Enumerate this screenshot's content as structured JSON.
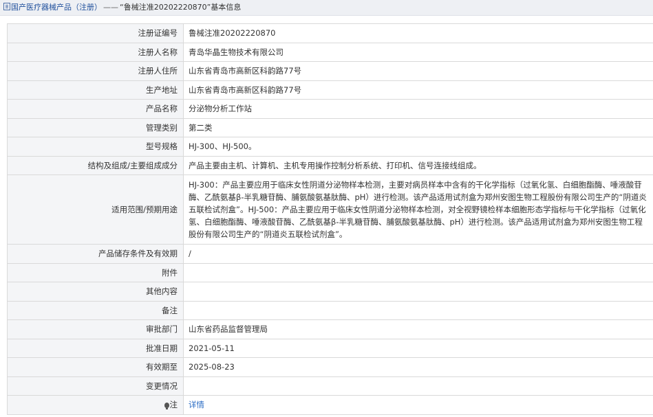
{
  "breadcrumb": {
    "home": "国产医疗器械产品（注册）",
    "separator": "——",
    "current": "“鲁械注准20202220870”基本信息"
  },
  "rows": [
    {
      "label": "注册证编号",
      "value": "鲁械注准20202220870"
    },
    {
      "label": "注册人名称",
      "value": "青岛华晶生物技术有限公司"
    },
    {
      "label": "注册人住所",
      "value": "山东省青岛市高新区科韵路77号"
    },
    {
      "label": "生产地址",
      "value": "山东省青岛市高新区科韵路77号"
    },
    {
      "label": "产品名称",
      "value": "分泌物分析工作站"
    },
    {
      "label": "管理类别",
      "value": "第二类"
    },
    {
      "label": "型号规格",
      "value": "HJ-300、HJ-500。"
    },
    {
      "label": "结构及组成/主要组成成分",
      "value": "产品主要由主机、计算机、主机专用操作控制分析系统、打印机、信号连接线组成。"
    },
    {
      "label": "适用范围/预期用途",
      "value": "HJ-300：产品主要应用于临床女性阴道分泌物样本检测，主要对病员样本中含有的干化学指标（过氧化氢、白细胞酯酶、唾液酸苷酶、乙酰氨基β-半乳糖苷酶、脯氨酸氨基肽酶、pH）进行检测。该产品适用试剂盒为郑州安图生物工程股份有限公司生产的“阴道炎五联检试剂盒”。HJ-500：产品主要应用于临床女性阴道分泌物样本检测，对全视野镜检样本细胞形态学指标与干化学指标（过氧化氢、白细胞酯酶、唾液酸苷酶、乙酰氨基β-半乳糖苷酶、脯氨酸氨基肽酶、pH）进行检测。该产品适用试剂盒为郑州安图生物工程股份有限公司生产的“阴道炎五联检试剂盒”。"
    },
    {
      "label": "产品储存条件及有效期",
      "value": "/"
    },
    {
      "label": "附件",
      "value": ""
    },
    {
      "label": "其他内容",
      "value": ""
    },
    {
      "label": "备注",
      "value": ""
    },
    {
      "label": "审批部门",
      "value": "山东省药品监督管理局"
    },
    {
      "label": "批准日期",
      "value": "2021-05-11"
    },
    {
      "label": "有效期至",
      "value": "2025-08-23"
    },
    {
      "label": "变更情况",
      "value": ""
    }
  ],
  "note": {
    "icon": "lightbulb-icon",
    "label": "注",
    "link": "详情"
  }
}
